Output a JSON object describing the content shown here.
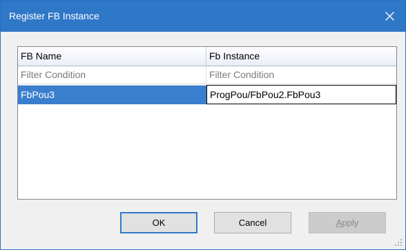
{
  "window": {
    "title": "Register FB Instance"
  },
  "grid": {
    "columns": [
      "FB Name",
      "Fb Instance"
    ],
    "filter_placeholders": [
      "Filter Condition",
      "Filter Condition"
    ],
    "rows": [
      {
        "fb_name": "FbPou3",
        "fb_instance": "ProgPou/FbPou2.FbPou3"
      }
    ]
  },
  "buttons": {
    "ok": "OK",
    "cancel": "Cancel",
    "apply_first": "A",
    "apply_rest": "pply"
  },
  "colors": {
    "titlebar": "#2f78c8",
    "selection": "#3a7fce"
  }
}
